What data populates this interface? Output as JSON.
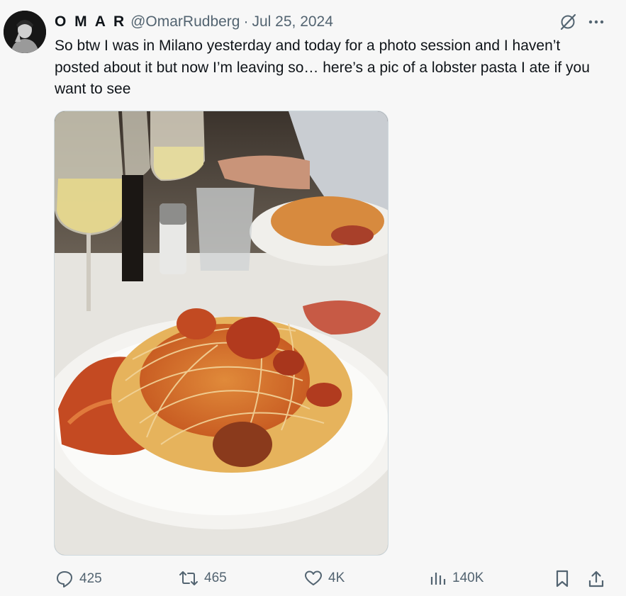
{
  "tweet": {
    "author_name": "O M A R",
    "handle": "@OmarRudberg",
    "separator": "·",
    "date": "Jul 25, 2024",
    "text": "So btw I was in Milano yesterday and today for a photo session and I haven’t posted about it but now I’m leaving so… here’s a pic of a lobster pasta I ate if you want to see"
  },
  "header_icons": {
    "grok": "grok-icon",
    "more": "more-icon"
  },
  "stats": {
    "replies": "425",
    "reposts": "465",
    "likes": "4K",
    "views": "140K"
  },
  "action_icons": [
    "reply-icon",
    "repost-icon",
    "like-icon",
    "views-icon",
    "bookmark-icon",
    "share-icon"
  ],
  "colors": {
    "text": "#0f1419",
    "muted": "#536471",
    "background": "#f7f7f7"
  }
}
